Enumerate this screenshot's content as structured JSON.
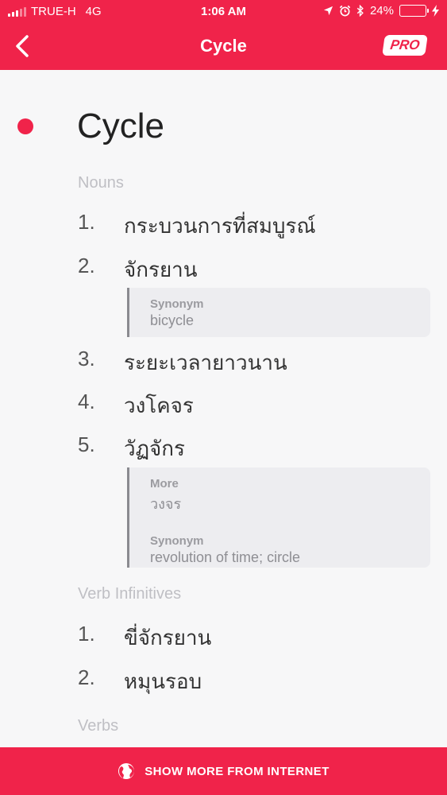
{
  "status_bar": {
    "carrier": "TRUE-H",
    "network": "4G",
    "time": "1:06 AM",
    "battery": "24%",
    "battery_level": 0.24,
    "icons": [
      "location-icon",
      "alarm-icon",
      "bluetooth-icon",
      "charging-icon"
    ]
  },
  "nav": {
    "title": "Cycle",
    "pro_label": "PRO",
    "back_icon": "chevron-left-icon"
  },
  "entry": {
    "word": "Cycle",
    "nouns_heading": "Nouns",
    "nouns": [
      {
        "num": "1.",
        "text": "กระบวนการที่สมบูรณ์"
      },
      {
        "num": "2.",
        "text": "จักรยาน"
      },
      {
        "num": "3.",
        "text": "ระยะเวลายาวนาน"
      },
      {
        "num": "4.",
        "text": "วงโคจร"
      },
      {
        "num": "5.",
        "text": "วัฏจักร"
      }
    ],
    "noun2_box": {
      "synonym_label": "Synonym",
      "synonym_value": "bicycle"
    },
    "noun5_box": {
      "more_label": "More",
      "more_value": "วงจร",
      "synonym_label": "Synonym",
      "synonym_value": "revolution of time; circle"
    },
    "verb_inf_heading": "Verb Infinitives",
    "verb_infinitives": [
      {
        "num": "1.",
        "text": "ขี่จักรยาน"
      },
      {
        "num": "2.",
        "text": "หมุนรอบ"
      }
    ],
    "verbs_heading": "Verbs"
  },
  "bottom_bar": {
    "label": "SHOW MORE FROM INTERNET",
    "icon": "globe-icon"
  },
  "colors": {
    "accent": "#f0234a",
    "background": "#f7f7f8",
    "box": "#ededf0"
  }
}
